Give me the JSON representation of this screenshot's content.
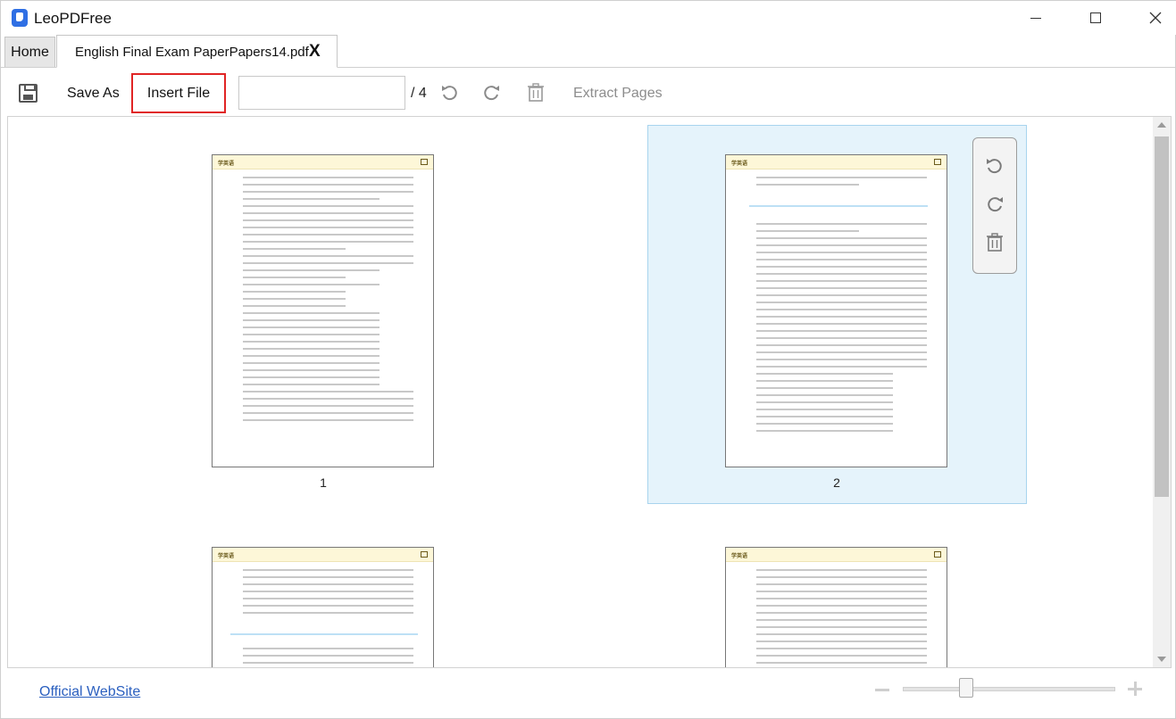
{
  "app": {
    "title": "LeoPDFree"
  },
  "tabs": [
    {
      "label": "Home"
    },
    {
      "label": "English Final Exam PaperPapers14.pdf",
      "close_label": "X"
    }
  ],
  "toolbar": {
    "save_as_label": "Save As",
    "insert_file_label": "Insert File",
    "page_input_value": "",
    "page_total": "/ 4",
    "extract_pages_label": "Extract Pages"
  },
  "pages": [
    {
      "number": "1",
      "selected": false
    },
    {
      "number": "2",
      "selected": true
    },
    {
      "number": "",
      "selected": false
    },
    {
      "number": "",
      "selected": false
    }
  ],
  "page_text": {
    "header_logo": "学英语"
  },
  "footer": {
    "official_website_label": "Official WebSite"
  },
  "zoom": {
    "level_fraction": 0.3
  },
  "colors": {
    "accent_red": "#e02424",
    "selection": "#e5f3fb",
    "link": "#2a5fbf"
  }
}
